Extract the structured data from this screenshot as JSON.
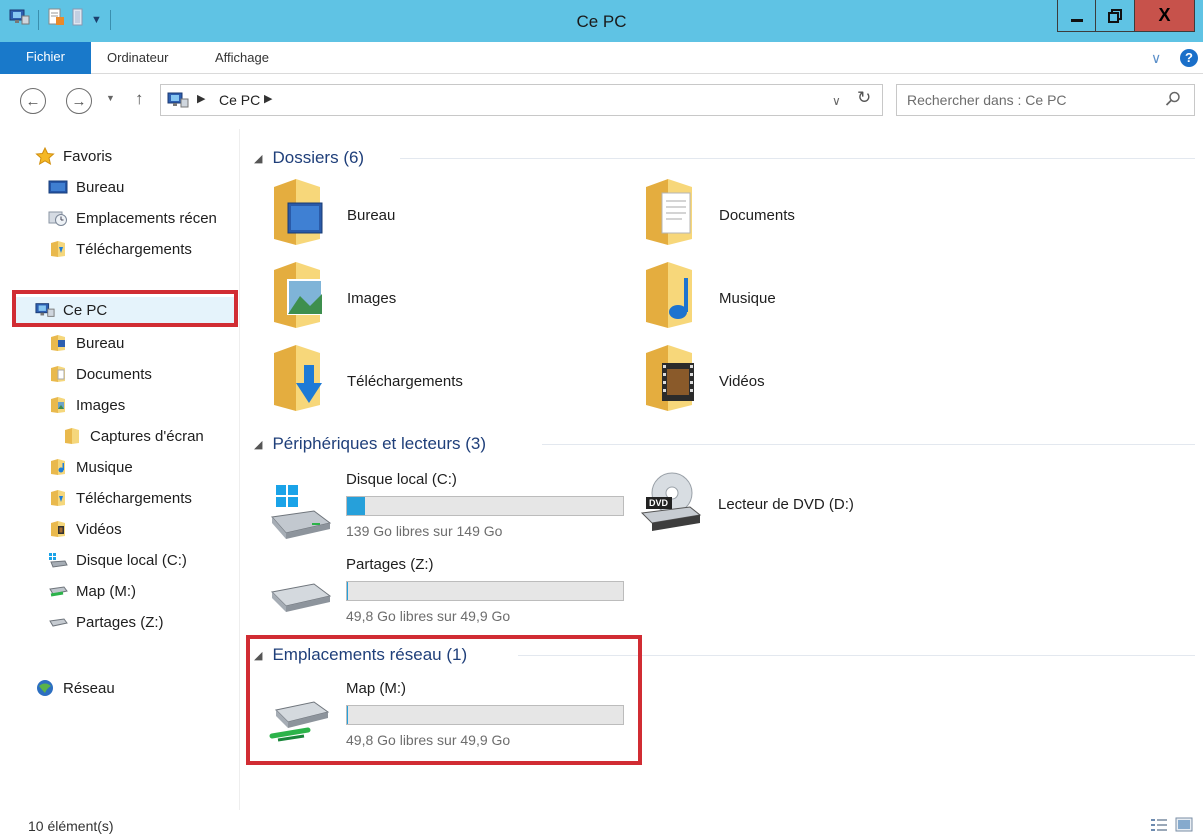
{
  "window": {
    "title": "Ce PC",
    "close_glyph": "X"
  },
  "ribbon": {
    "tabs": [
      {
        "label": "Fichier"
      },
      {
        "label": "Ordinateur"
      },
      {
        "label": "Affichage"
      }
    ],
    "help_glyph": "?"
  },
  "address": {
    "breadcrumb": [
      "Ce PC"
    ],
    "search_placeholder": "Rechercher dans : Ce PC"
  },
  "sidebar": {
    "favorites": {
      "label": "Favoris",
      "items": [
        {
          "label": "Bureau",
          "icon": "desktop-icon"
        },
        {
          "label": "Emplacements récen",
          "icon": "recent-places-icon"
        },
        {
          "label": "Téléchargements",
          "icon": "downloads-folder-icon"
        }
      ]
    },
    "this_pc": {
      "label": "Ce PC",
      "items": [
        {
          "label": "Bureau",
          "icon": "desktop-folder-icon"
        },
        {
          "label": "Documents",
          "icon": "documents-folder-icon"
        },
        {
          "label": "Images",
          "icon": "pictures-folder-icon"
        },
        {
          "label": "Captures d'écran",
          "icon": "folder-icon"
        },
        {
          "label": "Musique",
          "icon": "music-folder-icon"
        },
        {
          "label": "Téléchargements",
          "icon": "downloads-folder-icon"
        },
        {
          "label": "Vidéos",
          "icon": "videos-folder-icon"
        },
        {
          "label": "Disque local (C:)",
          "icon": "local-disk-icon"
        },
        {
          "label": "Map (M:)",
          "icon": "network-drive-icon"
        },
        {
          "label": "Partages (Z:)",
          "icon": "network-drive-disconnected-icon"
        }
      ]
    },
    "network": {
      "label": "Réseau"
    }
  },
  "main": {
    "folders": {
      "header": "Dossiers (6)",
      "items": [
        {
          "label": "Bureau",
          "icon": "desktop-folder-icon"
        },
        {
          "label": "Documents",
          "icon": "documents-folder-icon"
        },
        {
          "label": "Images",
          "icon": "pictures-folder-icon"
        },
        {
          "label": "Musique",
          "icon": "music-folder-icon"
        },
        {
          "label": "Téléchargements",
          "icon": "downloads-folder-icon"
        },
        {
          "label": "Vidéos",
          "icon": "videos-folder-icon"
        }
      ]
    },
    "devices": {
      "header": "Périphériques et lecteurs (3)",
      "drives": [
        {
          "label": "Disque local (C:)",
          "free": "139 Go libres sur 149 Go",
          "used_fraction": 0.067
        },
        {
          "label": "Partages (Z:)",
          "free": "49,8 Go libres sur 49,9 Go",
          "used_fraction": 0.002
        }
      ],
      "dvd": {
        "label": "Lecteur de DVD (D:)",
        "badge": "DVD"
      }
    },
    "network_locations": {
      "header": "Emplacements réseau (1)",
      "drive": {
        "label": "Map (M:)",
        "free": "49,8 Go libres sur 49,9 Go",
        "used_fraction": 0.002
      }
    }
  },
  "status": {
    "count": "10 élément(s)"
  },
  "colors": {
    "titlebar": "#5fc3e4",
    "file_tab": "#1979ca",
    "group_header": "#1f3f7a",
    "highlight": "#d12c33",
    "bar_fill": "#26a0da"
  }
}
